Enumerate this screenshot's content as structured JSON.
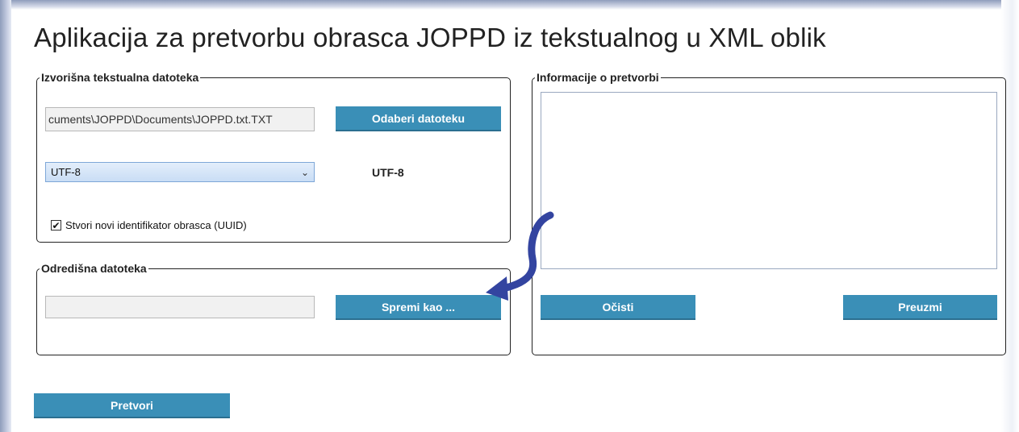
{
  "app": {
    "title": "Aplikacija za pretvorbu obrasca JOPPD iz tekstualnog u XML oblik"
  },
  "source": {
    "legend": "Izvorišna tekstualna datoteka",
    "file_path": "cuments\\JOPPD\\Documents\\JOPPD.txt.TXT",
    "choose_button": "Odaberi datoteku",
    "encoding_selected": "UTF-8",
    "encoding_label": "UTF-8",
    "uuid_checkbox_label": "Stvori novi identifikator obrasca (UUID)",
    "uuid_checked": true,
    "check_glyph": "✔",
    "chevron_glyph": "⌄"
  },
  "destination": {
    "legend": "Odredišna datoteka",
    "file_path": "",
    "save_button": "Spremi kao ..."
  },
  "info": {
    "legend": "Informacije o pretvorbi",
    "content": "",
    "clear_button": "Očisti",
    "download_button": "Preuzmi"
  },
  "actions": {
    "convert_button": "Pretvori"
  },
  "colors": {
    "button": "#3a8fb7",
    "arrow": "#3344a0"
  },
  "icons": {
    "arrow": "curved-arrow-icon"
  }
}
